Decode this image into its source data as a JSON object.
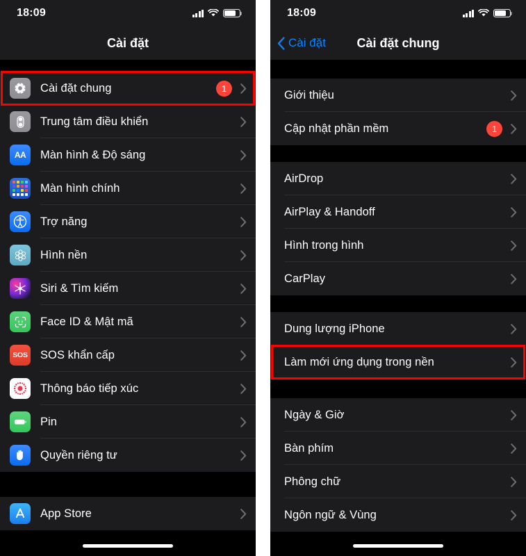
{
  "meta": {
    "platform": "iOS Settings (Vietnamese)",
    "accent_blue": "#0a84ff",
    "badge_red": "#ff453a",
    "highlight_red": "#ff0000",
    "row_bg": "#1c1c1e",
    "page_bg": "#000000"
  },
  "left_phone": {
    "status": {
      "time": "18:09",
      "signal_icon": "cellular-bars-icon",
      "wifi_icon": "wifi-icon",
      "battery_icon": "battery-icon"
    },
    "nav": {
      "title": "Cài đặt"
    },
    "sections": [
      {
        "rows": [
          {
            "label": "Cài đặt chung",
            "icon": "gear-icon",
            "icon_class": "ic-gear",
            "badge": "1",
            "highlighted": true
          },
          {
            "label": "Trung tâm điều khiển",
            "icon": "control-center-icon",
            "icon_class": "ic-control",
            "badge": "",
            "highlighted": false
          },
          {
            "label": "Màn hình & Độ sáng",
            "icon": "display-brightness-icon",
            "icon_class": "ic-display",
            "badge": "",
            "highlighted": false
          },
          {
            "label": "Màn hình chính",
            "icon": "home-screen-icon",
            "icon_class": "ic-home",
            "badge": "",
            "highlighted": false
          },
          {
            "label": "Trợ năng",
            "icon": "accessibility-icon",
            "icon_class": "ic-access",
            "badge": "",
            "highlighted": false
          },
          {
            "label": "Hình nền",
            "icon": "wallpaper-icon",
            "icon_class": "ic-wall",
            "badge": "",
            "highlighted": false
          },
          {
            "label": "Siri & Tìm kiếm",
            "icon": "siri-icon",
            "icon_class": "ic-siri",
            "badge": "",
            "highlighted": false
          },
          {
            "label": "Face ID & Mật mã",
            "icon": "face-id-icon",
            "icon_class": "ic-face",
            "badge": "",
            "highlighted": false
          },
          {
            "label": "SOS khẩn cấp",
            "icon": "emergency-sos-icon",
            "icon_class": "ic-sos",
            "badge": "",
            "highlighted": false
          },
          {
            "label": "Thông báo tiếp xúc",
            "icon": "exposure-notification-icon",
            "icon_class": "ic-expo",
            "badge": "",
            "highlighted": false
          },
          {
            "label": "Pin",
            "icon": "battery-settings-icon",
            "icon_class": "ic-batt",
            "badge": "",
            "highlighted": false
          },
          {
            "label": "Quyền riêng tư",
            "icon": "privacy-hand-icon",
            "icon_class": "ic-priv",
            "badge": "",
            "highlighted": false
          }
        ]
      },
      {
        "rows": [
          {
            "label": "App Store",
            "icon": "app-store-icon",
            "icon_class": "ic-appstore",
            "badge": "",
            "highlighted": false
          }
        ]
      }
    ]
  },
  "right_phone": {
    "status": {
      "time": "18:09",
      "signal_icon": "cellular-bars-icon",
      "wifi_icon": "wifi-icon",
      "battery_icon": "battery-icon"
    },
    "nav": {
      "back_label": "Cài đặt",
      "title": "Cài đặt chung",
      "back_icon": "chevron-left-icon"
    },
    "sections": [
      {
        "rows": [
          {
            "label": "Giới thiệu",
            "badge": "",
            "highlighted": false
          },
          {
            "label": "Cập nhật phần mềm",
            "badge": "1",
            "highlighted": false
          }
        ]
      },
      {
        "rows": [
          {
            "label": "AirDrop",
            "badge": "",
            "highlighted": false
          },
          {
            "label": "AirPlay & Handoff",
            "badge": "",
            "highlighted": false
          },
          {
            "label": "Hình trong hình",
            "badge": "",
            "highlighted": false
          },
          {
            "label": "CarPlay",
            "badge": "",
            "highlighted": false
          }
        ]
      },
      {
        "rows": [
          {
            "label": "Dung lượng iPhone",
            "badge": "",
            "highlighted": false
          },
          {
            "label": "Làm mới ứng dụng trong nền",
            "badge": "",
            "highlighted": true
          }
        ]
      },
      {
        "rows": [
          {
            "label": "Ngày & Giờ",
            "badge": "",
            "highlighted": false
          },
          {
            "label": "Bàn phím",
            "badge": "",
            "highlighted": false
          },
          {
            "label": "Phông chữ",
            "badge": "",
            "highlighted": false
          },
          {
            "label": "Ngôn ngữ & Vùng",
            "badge": "",
            "highlighted": false
          }
        ]
      }
    ]
  }
}
